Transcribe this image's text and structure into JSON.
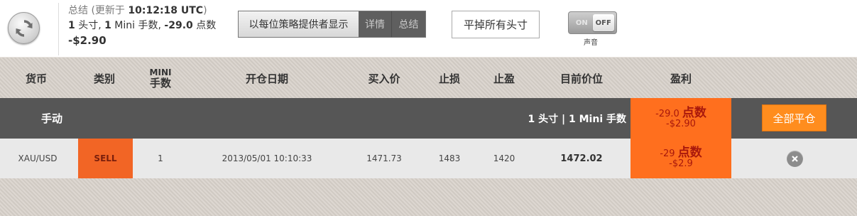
{
  "summary": {
    "status_prefix": "总结 (更新于 ",
    "time": "10:12:18 UTC",
    "status_suffix": ")",
    "positions_count": "1",
    "positions_label": " 头寸, ",
    "mini_count": "1",
    "mini_label": " Mini 手数, ",
    "points": "-29.0",
    "points_label": " 点数",
    "usd": "-$2.90"
  },
  "view_toggle": {
    "by_provider": "以每位策略提供者显示",
    "detail": "详情",
    "summary": "总结"
  },
  "close_all_top": "平掉所有头寸",
  "sound": {
    "on": "ON",
    "off": "OFF",
    "label": "声音"
  },
  "columns": {
    "currency": "货币",
    "type": "类别",
    "mini_top": "MINI",
    "mini_bottom": "手数",
    "open_date": "开仓日期",
    "buy_price": "买入价",
    "stop_loss": "止损",
    "take_profit": "止盈",
    "current_price": "目前价位",
    "pnl": "盈利"
  },
  "group": {
    "name": "手动",
    "count_text": "1 头寸 | 1 Mini 手数",
    "points": "-29.0",
    "points_label": "点数",
    "usd": "-$2.90",
    "close_all": "全部平仓"
  },
  "positions": [
    {
      "currency": "XAU/USD",
      "type": "SELL",
      "mini": "1",
      "open_date": "2013/05/01 10:10:33",
      "buy_price": "1471.73",
      "stop_loss": "1483",
      "take_profit": "1420",
      "current_price": "1472.02",
      "points": "-29",
      "points_label": "点数",
      "usd": "-$2.9"
    }
  ],
  "colors": {
    "pnl_bg": "#ff6f1e",
    "sell_bg": "#f26525",
    "close_all_bg": "#ff8d1e",
    "group_row_bg": "#565656"
  },
  "icons": [
    "refresh-icon",
    "close-circle-icon"
  ]
}
